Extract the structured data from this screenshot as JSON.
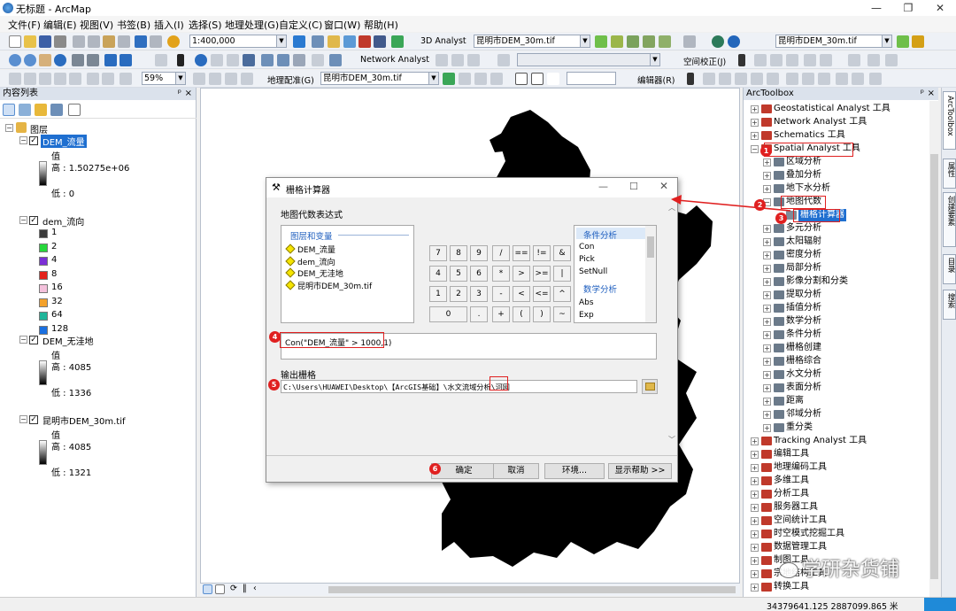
{
  "window": {
    "title": "无标题 - ArcMap",
    "controls": [
      "—",
      "❐",
      "✕"
    ]
  },
  "menu": [
    "文件(F)",
    "编辑(E)",
    "视图(V)",
    "书签(B)",
    "插入(I)",
    "选择(S)",
    "地理处理(G)",
    "自定义(C)",
    "窗口(W)",
    "帮助(H)"
  ],
  "toolbar": {
    "scale": "1:400,000",
    "analyst3d": "3D Analyst",
    "layer1": "昆明市DEM_30m.tif",
    "layer2": "昆明市DEM_30m.tif",
    "network": "Network Analyst",
    "zoom": "59%",
    "georef": "地理配准(G)",
    "georef_layer": "昆明市DEM_30m.tif",
    "spatial_adjust": "空间校正(J)",
    "editor": "编辑器(R)"
  },
  "toc": {
    "title": "内容列表",
    "root": "图层",
    "layers": [
      {
        "name": "DEM_流量",
        "value_label": "值",
        "high": "高 : 1.50275e+06",
        "low": "低 : 0"
      },
      {
        "name": "dem_流向",
        "classes": [
          {
            "label": "1",
            "color": "#3a3a3a"
          },
          {
            "label": "2",
            "color": "#27d73b"
          },
          {
            "label": "4",
            "color": "#7c2fd6"
          },
          {
            "label": "8",
            "color": "#e4221c"
          },
          {
            "label": "16",
            "color": "#f4c1dc"
          },
          {
            "label": "32",
            "color": "#f3a12b"
          },
          {
            "label": "64",
            "color": "#1fb59a"
          },
          {
            "label": "128",
            "color": "#1a6fe0"
          }
        ]
      },
      {
        "name": "DEM_无洼地",
        "value_label": "值",
        "high": "高 : 4085",
        "low": "低 : 1336"
      },
      {
        "name": "昆明市DEM_30m.tif",
        "value_label": "值",
        "high": "高 : 4085",
        "low": "低 : 1321"
      }
    ]
  },
  "dialog": {
    "title": "栅格计算器",
    "section_expr": "地图代数表达式",
    "layers_header": "图层和变量",
    "layers": [
      "DEM_流量",
      "dem_流向",
      "DEM_无洼地",
      "昆明市DEM_30m.tif"
    ],
    "keys": [
      [
        "7",
        "8",
        "9",
        "/",
        "==",
        "!=",
        "&"
      ],
      [
        "4",
        "5",
        "6",
        "*",
        ">",
        ">=",
        "|"
      ],
      [
        "1",
        "2",
        "3",
        "-",
        "<",
        "<=",
        "^"
      ],
      [
        "0",
        ".",
        "+",
        "(",
        ")",
        "~"
      ]
    ],
    "func_header1": "条件分析",
    "funcs1": [
      "Con",
      "Pick",
      "SetNull"
    ],
    "func_header2": "数学分析",
    "funcs2": [
      "Abs",
      "Exp"
    ],
    "expression": "Con(\"DEM_流量\" > 1000,1)",
    "output_label": "输出栅格",
    "output_path": "C:\\Users\\HUAWEI\\Desktop\\【ArcGIS基础】\\水文流域分析\\河网",
    "buttons": {
      "ok": "确定",
      "cancel": "取消",
      "env": "环境...",
      "help": "显示帮助 >>"
    }
  },
  "arctoolbox": {
    "title": "ArcToolbox",
    "items": [
      {
        "label": "Geostatistical Analyst 工具",
        "level": 0,
        "kind": "box"
      },
      {
        "label": "Network Analyst 工具",
        "level": 0,
        "kind": "box"
      },
      {
        "label": "Schematics 工具",
        "level": 0,
        "kind": "box"
      },
      {
        "label": "Spatial Analyst 工具",
        "level": 0,
        "kind": "box",
        "open": true
      },
      {
        "label": "区域分析",
        "level": 1,
        "kind": "set"
      },
      {
        "label": "叠加分析",
        "level": 1,
        "kind": "set"
      },
      {
        "label": "地下水分析",
        "level": 1,
        "kind": "set"
      },
      {
        "label": "地图代数",
        "level": 1,
        "kind": "set",
        "open": true
      },
      {
        "label": "栅格计算器",
        "level": 2,
        "kind": "tool",
        "selected": true
      },
      {
        "label": "多元分析",
        "level": 1,
        "kind": "set"
      },
      {
        "label": "太阳辐射",
        "level": 1,
        "kind": "set"
      },
      {
        "label": "密度分析",
        "level": 1,
        "kind": "set"
      },
      {
        "label": "局部分析",
        "level": 1,
        "kind": "set"
      },
      {
        "label": "影像分割和分类",
        "level": 1,
        "kind": "set"
      },
      {
        "label": "提取分析",
        "level": 1,
        "kind": "set"
      },
      {
        "label": "插值分析",
        "level": 1,
        "kind": "set"
      },
      {
        "label": "数学分析",
        "level": 1,
        "kind": "set"
      },
      {
        "label": "条件分析",
        "level": 1,
        "kind": "set"
      },
      {
        "label": "栅格创建",
        "level": 1,
        "kind": "set"
      },
      {
        "label": "栅格综合",
        "level": 1,
        "kind": "set"
      },
      {
        "label": "水文分析",
        "level": 1,
        "kind": "set"
      },
      {
        "label": "表面分析",
        "level": 1,
        "kind": "set"
      },
      {
        "label": "距离",
        "level": 1,
        "kind": "set"
      },
      {
        "label": "邻域分析",
        "level": 1,
        "kind": "set"
      },
      {
        "label": "重分类",
        "level": 1,
        "kind": "set"
      },
      {
        "label": "Tracking Analyst 工具",
        "level": 0,
        "kind": "box"
      },
      {
        "label": "编辑工具",
        "level": 0,
        "kind": "box"
      },
      {
        "label": "地理编码工具",
        "level": 0,
        "kind": "box"
      },
      {
        "label": "多维工具",
        "level": 0,
        "kind": "box"
      },
      {
        "label": "分析工具",
        "level": 0,
        "kind": "box"
      },
      {
        "label": "服务器工具",
        "level": 0,
        "kind": "box"
      },
      {
        "label": "空间统计工具",
        "level": 0,
        "kind": "box"
      },
      {
        "label": "时空模式挖掘工具",
        "level": 0,
        "kind": "box"
      },
      {
        "label": "数据管理工具",
        "level": 0,
        "kind": "box"
      },
      {
        "label": "制图工具",
        "level": 0,
        "kind": "box"
      },
      {
        "label": "宗地结构工具",
        "level": 0,
        "kind": "box"
      },
      {
        "label": "转换工具",
        "level": 0,
        "kind": "box"
      }
    ]
  },
  "side_tabs": [
    "ArcToolbox",
    "属性",
    "创建要素",
    "目录",
    "搜索"
  ],
  "annotations": [
    "1",
    "2",
    "3",
    "4",
    "5",
    "6"
  ],
  "watermark": "学研杂货铺",
  "status": {
    "coords": "34379641.125 2887099.865 米"
  }
}
